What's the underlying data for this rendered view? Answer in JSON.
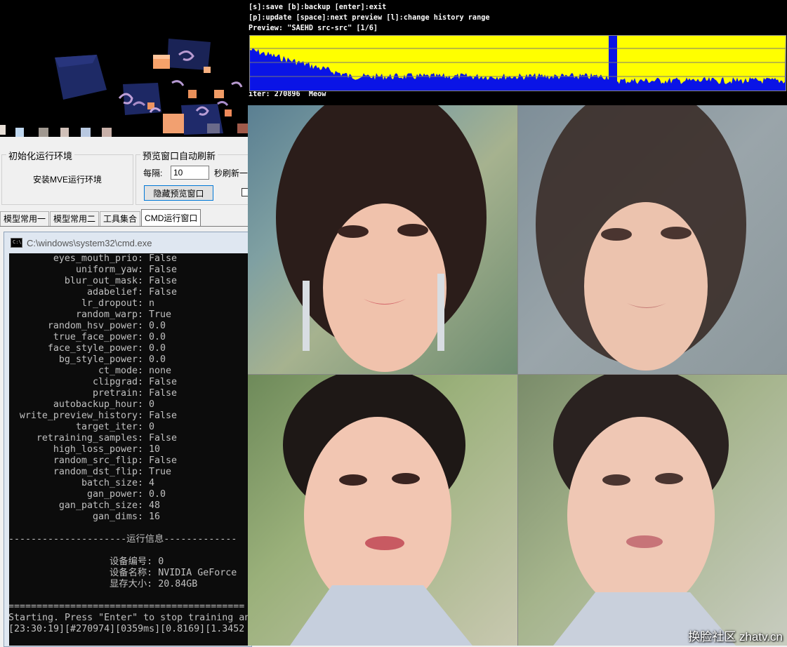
{
  "panel": {
    "init_group_title": "初始化运行环境",
    "install_button": "安装MVE运行环境",
    "refresh_group_title": "预览窗口自动刷新",
    "interval_label": "每隔:",
    "interval_value": "10",
    "interval_unit": "秒刷新一",
    "hide_preview_button": "隐藏预览窗口"
  },
  "tabs": [
    {
      "label": "模型常用一"
    },
    {
      "label": "模型常用二"
    },
    {
      "label": "工具集合"
    },
    {
      "label": "CMD运行窗口"
    }
  ],
  "cmd": {
    "title": "C:\\windows\\system32\\cmd.exe",
    "params": [
      {
        "k": "eyes_mouth_prio",
        "v": "False"
      },
      {
        "k": "uniform_yaw",
        "v": "False"
      },
      {
        "k": "blur_out_mask",
        "v": "False"
      },
      {
        "k": "adabelief",
        "v": "False"
      },
      {
        "k": "lr_dropout",
        "v": "n"
      },
      {
        "k": "random_warp",
        "v": "True"
      },
      {
        "k": "random_hsv_power",
        "v": "0.0"
      },
      {
        "k": "true_face_power",
        "v": "0.0"
      },
      {
        "k": "face_style_power",
        "v": "0.0"
      },
      {
        "k": "bg_style_power",
        "v": "0.0"
      },
      {
        "k": "ct_mode",
        "v": "none"
      },
      {
        "k": "clipgrad",
        "v": "False"
      },
      {
        "k": "pretrain",
        "v": "False"
      },
      {
        "k": "autobackup_hour",
        "v": "0"
      },
      {
        "k": "write_preview_history",
        "v": "False"
      },
      {
        "k": "target_iter",
        "v": "0"
      },
      {
        "k": "retraining_samples",
        "v": "False"
      },
      {
        "k": "high_loss_power",
        "v": "10"
      },
      {
        "k": "random_src_flip",
        "v": "False"
      },
      {
        "k": "random_dst_flip",
        "v": "True"
      },
      {
        "k": "batch_size",
        "v": "4"
      },
      {
        "k": "gan_power",
        "v": "0.0"
      },
      {
        "k": "gan_patch_size",
        "v": "48"
      },
      {
        "k": "gan_dims",
        "v": "16"
      }
    ],
    "section_line": "---------------------运行信息-------------",
    "device_num": "设备编号: 0",
    "device_name": "设备名称: NVIDIA GeForce",
    "vram": "显存大小: 20.84GB",
    "separator": "==========================================",
    "starting": "Starting. Press \"Enter\" to stop training an",
    "status": "[23:30:19][#270974][0359ms][0.8169][1.3452"
  },
  "preview": {
    "line1": "[s]:save [b]:backup [enter]:exit",
    "line2": "[p]:update [space]:next preview [l]:change history range",
    "line3": "Preview: \"SAEHD src-src\" [1/6]",
    "iter": "iter: 270896  Meow"
  },
  "watermark": "换脸社区 zhatv.cn",
  "colors": {
    "graph_yellow": "#ffff00",
    "graph_blue": "#0a14e6",
    "console_bg": "#0c0c0c",
    "console_text": "#c0c0c0"
  }
}
